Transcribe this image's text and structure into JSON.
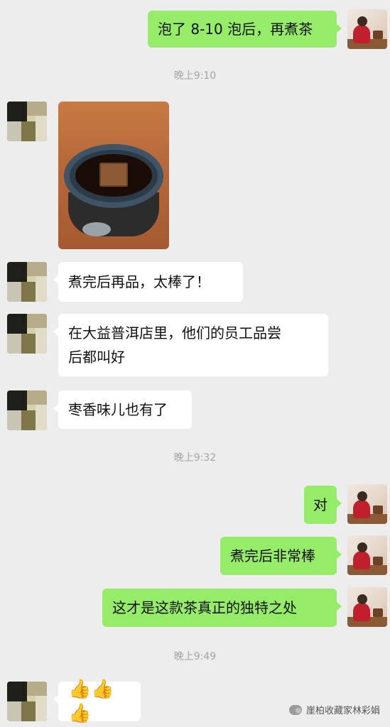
{
  "messages": {
    "m1": "泡了 8-10 泡后，再煮茶",
    "m2": "煮完后再品，太棒了！",
    "m3_line1": "在大益普洱店里，他们的员工品尝",
    "m3_line2": "后都叫好",
    "m4": "枣香味儿也有了",
    "m5": "对",
    "m6": "煮完后非常棒",
    "m7": "这才是这款茶真正的独特之处",
    "m8": "👍👍👍"
  },
  "timestamps": {
    "t1": "晚上9:10",
    "t2": "晚上9:32",
    "t3": "晚上9:49"
  },
  "watermark": {
    "text": "崖柏收藏家林彩娟"
  },
  "colors": {
    "background": "#ededed",
    "sent_bubble": "#95ec69",
    "received_bubble": "#ffffff"
  }
}
